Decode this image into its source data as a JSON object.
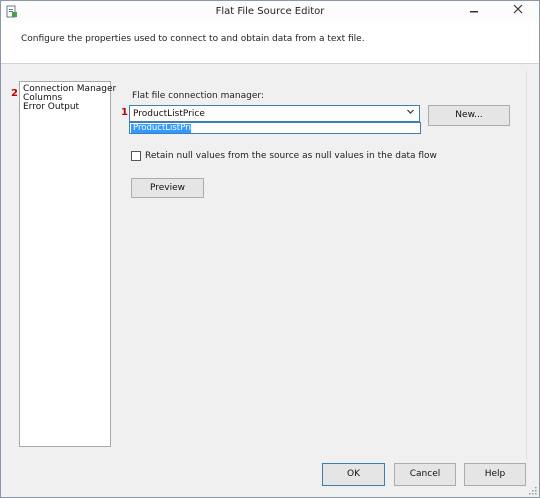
{
  "window": {
    "title": "Flat File Source Editor",
    "minimize_icon": "minimize-icon",
    "close_icon": "close-icon"
  },
  "header": {
    "description": "Configure the properties used to connect to and obtain data from a text file."
  },
  "nav": {
    "marker": "2",
    "items": [
      {
        "label": "Connection Manager"
      },
      {
        "label": "Columns"
      },
      {
        "label": "Error Output"
      }
    ]
  },
  "connection": {
    "marker": "1",
    "label": "Flat file connection manager:",
    "selected": "ProductListPrice",
    "options": [
      "ProductListPrice"
    ],
    "new_button": "New..."
  },
  "retain_nulls": {
    "label": "Retain null values from the source as null values in the data flow",
    "checked": false
  },
  "preview_button": "Preview",
  "footer": {
    "ok": "OK",
    "cancel": "Cancel",
    "help": "Help"
  },
  "colors": {
    "selection": "#3399ff",
    "marker": "#c00000",
    "focus_border": "#3c7fb1"
  }
}
